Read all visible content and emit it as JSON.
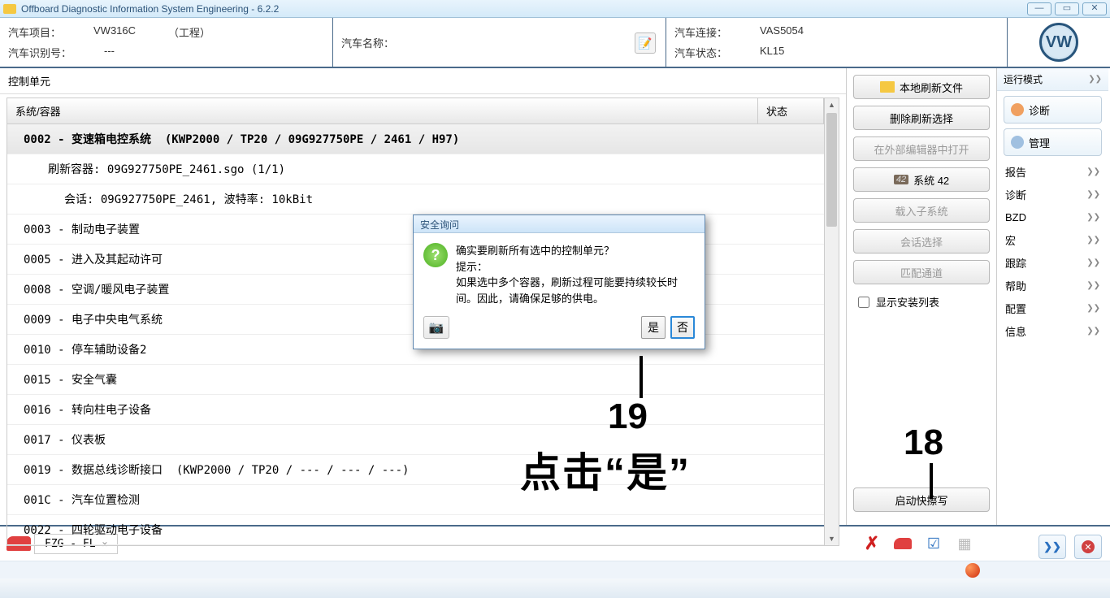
{
  "titlebar": {
    "title": "Offboard Diagnostic Information System Engineering - 6.2.2"
  },
  "info": {
    "project_label": "汽车项目：",
    "project_value": "VW316C",
    "project_note": "（工程）",
    "vin_label": "汽车识别号：",
    "vin_value": "---",
    "name_label": "汽车名称：",
    "conn_label": "汽车连接：",
    "conn_value": "VAS5054",
    "state_label": "汽车状态：",
    "state_value": "KL15"
  },
  "section": {
    "title": "控制单元"
  },
  "grid": {
    "col_system": "系统/容器",
    "col_state": "状态",
    "rows": [
      {
        "text": "0002 - 变速箱电控系统  (KWP2000 / TP20 / 09G927750PE / 2461 / H97)",
        "selected": true,
        "indent": 0
      },
      {
        "text": "刷新容器: 09G927750PE_2461.sgo (1/1)",
        "indent": 1
      },
      {
        "text": "会话: 09G927750PE_2461, 波特率: 10kBit",
        "indent": 2
      },
      {
        "text": "0003 - 制动电子装置",
        "indent": 0
      },
      {
        "text": "0005 - 进入及其起动许可",
        "indent": 0
      },
      {
        "text": "0008 - 空调/暖风电子装置",
        "indent": 0
      },
      {
        "text": "0009 - 电子中央电气系统",
        "indent": 0
      },
      {
        "text": "0010 - 停车辅助设备2",
        "indent": 0
      },
      {
        "text": "0015 - 安全气囊",
        "indent": 0
      },
      {
        "text": "0016 - 转向柱电子设备",
        "indent": 0
      },
      {
        "text": "0017 - 仪表板",
        "indent": 0
      },
      {
        "text": "0019 - 数据总线诊断接口  (KWP2000 / TP20 / --- / --- / ---)",
        "indent": 0
      },
      {
        "text": "001C - 汽车位置检测",
        "indent": 0
      },
      {
        "text": "0022 - 四轮驱动电子设备",
        "indent": 0
      }
    ]
  },
  "mid": {
    "btn_local_refresh": "本地刷新文件",
    "btn_delete_refresh": "删除刷新选择",
    "btn_open_external": "在外部编辑器中打开",
    "btn_system42": "系统 42",
    "btn_load_sub": "载入子系统",
    "btn_session_sel": "会话选择",
    "btn_match_ch": "匹配通道",
    "chk_show_install": "显示安装列表",
    "btn_start_flash": "启动快擦写"
  },
  "right": {
    "header": "运行模式",
    "btn_diag": "诊断",
    "btn_admin": "管理",
    "items": [
      "报告",
      "诊断",
      "BZD",
      "宏",
      "跟踪",
      "帮助",
      "配置",
      "信息"
    ]
  },
  "bottom": {
    "tab": "FZG - FL"
  },
  "modal": {
    "title": "安全询问",
    "line1": "确实要刷新所有选中的控制单元？",
    "line2": "提示：",
    "line3": "如果选中多个容器，刷新过程可能要持续较长时间。因此，请确保足够的供电。",
    "yes": "是",
    "no": "否"
  },
  "annotations": {
    "a19_num": "19",
    "a19_text": "点击“是”",
    "a18_num": "18"
  }
}
